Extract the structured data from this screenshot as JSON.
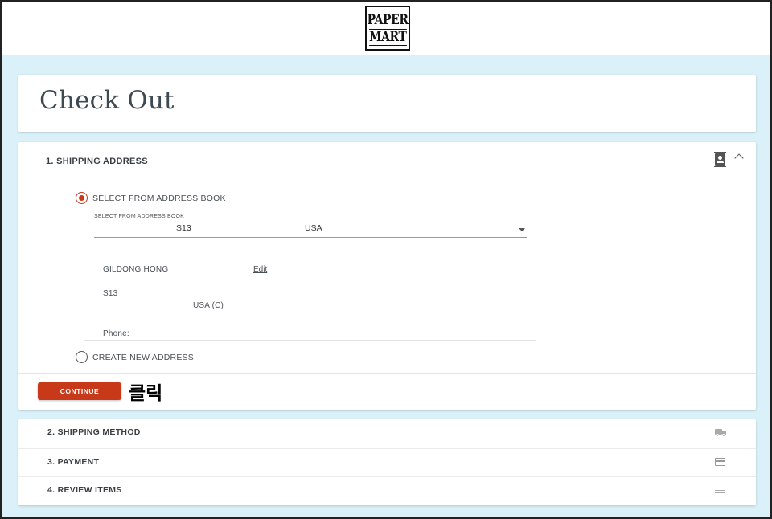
{
  "header": {
    "logo_line1": "PAPER",
    "logo_line2": "MART"
  },
  "page": {
    "title": "Check Out"
  },
  "shipping": {
    "title": "1. SHIPPING ADDRESS",
    "option_address_book": "SELECT FROM ADDRESS BOOK",
    "option_address_book_selected": true,
    "select_caption": "SELECT FROM ADDRESS BOOK",
    "select_value_part1": "S13",
    "select_value_part2": "USA",
    "address": {
      "name": "GILDONG HONG",
      "edit_label": "Edit",
      "line1": "S13",
      "line2": "USA (C)",
      "phone_label": "Phone:"
    },
    "option_new_address": "CREATE NEW ADDRESS",
    "continue_label": "CONTINUE",
    "annotation": "클릭"
  },
  "steps": [
    {
      "label": "2. SHIPPING METHOD",
      "icon": "truck-icon"
    },
    {
      "label": "3. PAYMENT",
      "icon": "credit-card-icon"
    },
    {
      "label": "4. REVIEW ITEMS",
      "icon": "list-icon"
    }
  ],
  "colors": {
    "accent": "#c8391a",
    "background": "#dbf1fa",
    "title_text": "#3e4a52"
  }
}
